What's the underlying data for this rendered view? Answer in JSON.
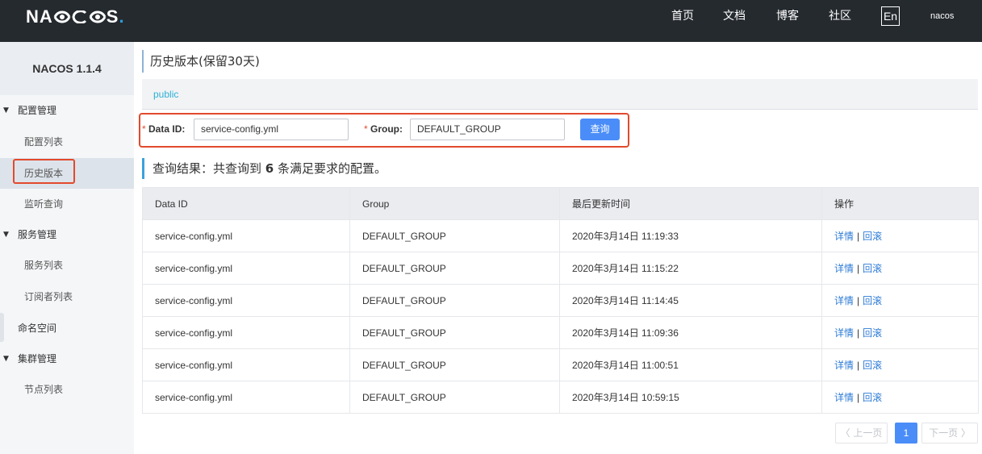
{
  "header": {
    "logo_prefix": "NA",
    "logo_suffix": "S",
    "logo_dot": ".",
    "nav": [
      "首页",
      "文档",
      "博客",
      "社区"
    ],
    "lang": "En",
    "user": "nacos"
  },
  "sidebar": {
    "version": "NACOS 1.1.4",
    "items": [
      {
        "label": "配置管理"
      },
      {
        "label": "配置列表"
      },
      {
        "label": "历史版本"
      },
      {
        "label": "监听查询"
      },
      {
        "label": "服务管理"
      },
      {
        "label": "服务列表"
      },
      {
        "label": "订阅者列表"
      },
      {
        "label": "命名空间"
      },
      {
        "label": "集群管理"
      },
      {
        "label": "节点列表"
      }
    ]
  },
  "main": {
    "title": "历史版本(保留30天)",
    "namespace": "public",
    "search": {
      "dataid_label": "Data ID:",
      "dataid_value": "service-config.yml",
      "group_label": "Group:",
      "group_value": "DEFAULT_GROUP",
      "required_mark": "*",
      "query_button": "查询"
    },
    "result": {
      "prefix": "查询结果：共查询到",
      "count": "6",
      "suffix": "条满足要求的配置。"
    },
    "table": {
      "headers": [
        "Data ID",
        "Group",
        "最后更新时间",
        "操作"
      ],
      "rows": [
        {
          "dataid": "service-config.yml",
          "group": "DEFAULT_GROUP",
          "time": "2020年3月14日 11:19:33"
        },
        {
          "dataid": "service-config.yml",
          "group": "DEFAULT_GROUP",
          "time": "2020年3月14日 11:15:22"
        },
        {
          "dataid": "service-config.yml",
          "group": "DEFAULT_GROUP",
          "time": "2020年3月14日 11:14:45"
        },
        {
          "dataid": "service-config.yml",
          "group": "DEFAULT_GROUP",
          "time": "2020年3月14日 11:09:36"
        },
        {
          "dataid": "service-config.yml",
          "group": "DEFAULT_GROUP",
          "time": "2020年3月14日 11:00:51"
        },
        {
          "dataid": "service-config.yml",
          "group": "DEFAULT_GROUP",
          "time": "2020年3月14日 10:59:15"
        }
      ],
      "op_detail": "详情",
      "op_separator": "|",
      "op_rollback": "回滚"
    },
    "pagination": {
      "prev": "〈 上一页",
      "current": "1",
      "next": "下一页 〉"
    }
  },
  "colors": {
    "header_bg": "#252a2f",
    "highlight_border": "#e24a2d",
    "primary_button": "#4b8df8",
    "link": "#2d7bd6",
    "namespace_text": "#2bb1d6"
  }
}
